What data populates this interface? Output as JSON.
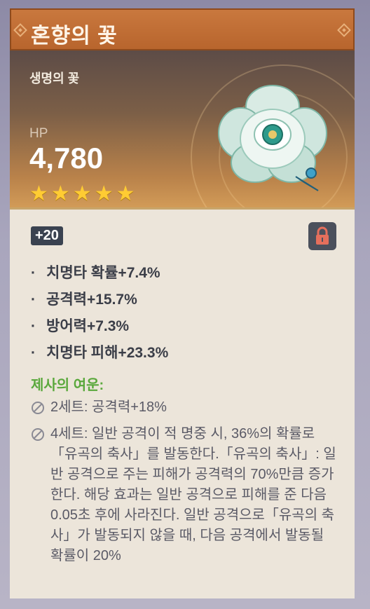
{
  "item": {
    "name": "혼향의 꽃",
    "type": "생명의 꽃",
    "main_stat": {
      "label": "HP",
      "value": "4,780"
    },
    "rarity": 5,
    "stars": [
      "★",
      "★",
      "★",
      "★",
      "★"
    ],
    "level": "+20",
    "locked": true,
    "substats": [
      "치명타 확률+7.4%",
      "공격력+15.7%",
      "방어력+7.3%",
      "치명타 피해+23.3%"
    ],
    "set_name": "제사의 여운:",
    "set_effects": [
      {
        "icon": "slash-circle-icon",
        "text": "2세트: 공격력+18%"
      },
      {
        "icon": "slash-circle-icon",
        "text": "4세트: 일반 공격이 적 명중 시, 36%의 확률로「유곡의 축사」를 발동한다.「유곡의 축사」: 일반 공격으로 주는 피해가 공격력의 70%만큼 증가한다. 해당 효과는 일반 공격으로 피해를 준 다음 0.05초 후에 사라진다. 일반 공격으로「유곡의 축사」가 발동되지 않을 때, 다음 공격에서 발동될 확률이 20%"
      }
    ]
  },
  "colors": {
    "title_bar": "#b8652d",
    "star": "#ffcc33",
    "set_name": "#5aa83c",
    "lock_icon": "#e56f5c"
  }
}
